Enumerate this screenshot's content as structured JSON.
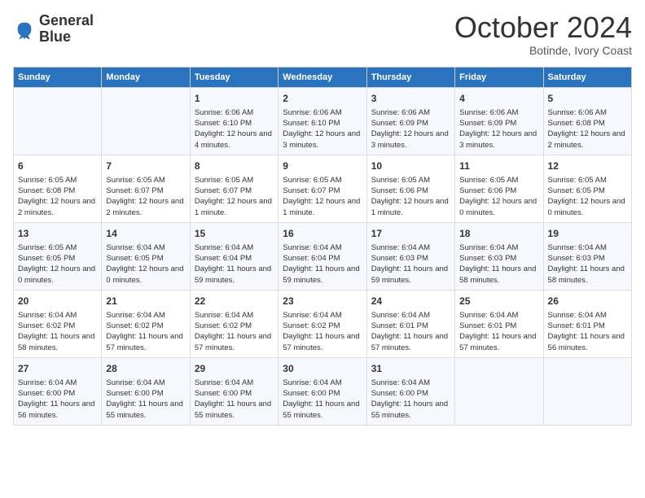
{
  "logo": {
    "line1": "General",
    "line2": "Blue"
  },
  "header": {
    "month": "October 2024",
    "location": "Botinde, Ivory Coast"
  },
  "weekdays": [
    "Sunday",
    "Monday",
    "Tuesday",
    "Wednesday",
    "Thursday",
    "Friday",
    "Saturday"
  ],
  "weeks": [
    [
      {
        "day": "",
        "info": ""
      },
      {
        "day": "",
        "info": ""
      },
      {
        "day": "1",
        "info": "Sunrise: 6:06 AM\nSunset: 6:10 PM\nDaylight: 12 hours and 4 minutes."
      },
      {
        "day": "2",
        "info": "Sunrise: 6:06 AM\nSunset: 6:10 PM\nDaylight: 12 hours and 3 minutes."
      },
      {
        "day": "3",
        "info": "Sunrise: 6:06 AM\nSunset: 6:09 PM\nDaylight: 12 hours and 3 minutes."
      },
      {
        "day": "4",
        "info": "Sunrise: 6:06 AM\nSunset: 6:09 PM\nDaylight: 12 hours and 3 minutes."
      },
      {
        "day": "5",
        "info": "Sunrise: 6:06 AM\nSunset: 6:08 PM\nDaylight: 12 hours and 2 minutes."
      }
    ],
    [
      {
        "day": "6",
        "info": "Sunrise: 6:05 AM\nSunset: 6:08 PM\nDaylight: 12 hours and 2 minutes."
      },
      {
        "day": "7",
        "info": "Sunrise: 6:05 AM\nSunset: 6:07 PM\nDaylight: 12 hours and 2 minutes."
      },
      {
        "day": "8",
        "info": "Sunrise: 6:05 AM\nSunset: 6:07 PM\nDaylight: 12 hours and 1 minute."
      },
      {
        "day": "9",
        "info": "Sunrise: 6:05 AM\nSunset: 6:07 PM\nDaylight: 12 hours and 1 minute."
      },
      {
        "day": "10",
        "info": "Sunrise: 6:05 AM\nSunset: 6:06 PM\nDaylight: 12 hours and 1 minute."
      },
      {
        "day": "11",
        "info": "Sunrise: 6:05 AM\nSunset: 6:06 PM\nDaylight: 12 hours and 0 minutes."
      },
      {
        "day": "12",
        "info": "Sunrise: 6:05 AM\nSunset: 6:05 PM\nDaylight: 12 hours and 0 minutes."
      }
    ],
    [
      {
        "day": "13",
        "info": "Sunrise: 6:05 AM\nSunset: 6:05 PM\nDaylight: 12 hours and 0 minutes."
      },
      {
        "day": "14",
        "info": "Sunrise: 6:04 AM\nSunset: 6:05 PM\nDaylight: 12 hours and 0 minutes."
      },
      {
        "day": "15",
        "info": "Sunrise: 6:04 AM\nSunset: 6:04 PM\nDaylight: 11 hours and 59 minutes."
      },
      {
        "day": "16",
        "info": "Sunrise: 6:04 AM\nSunset: 6:04 PM\nDaylight: 11 hours and 59 minutes."
      },
      {
        "day": "17",
        "info": "Sunrise: 6:04 AM\nSunset: 6:03 PM\nDaylight: 11 hours and 59 minutes."
      },
      {
        "day": "18",
        "info": "Sunrise: 6:04 AM\nSunset: 6:03 PM\nDaylight: 11 hours and 58 minutes."
      },
      {
        "day": "19",
        "info": "Sunrise: 6:04 AM\nSunset: 6:03 PM\nDaylight: 11 hours and 58 minutes."
      }
    ],
    [
      {
        "day": "20",
        "info": "Sunrise: 6:04 AM\nSunset: 6:02 PM\nDaylight: 11 hours and 58 minutes."
      },
      {
        "day": "21",
        "info": "Sunrise: 6:04 AM\nSunset: 6:02 PM\nDaylight: 11 hours and 57 minutes."
      },
      {
        "day": "22",
        "info": "Sunrise: 6:04 AM\nSunset: 6:02 PM\nDaylight: 11 hours and 57 minutes."
      },
      {
        "day": "23",
        "info": "Sunrise: 6:04 AM\nSunset: 6:02 PM\nDaylight: 11 hours and 57 minutes."
      },
      {
        "day": "24",
        "info": "Sunrise: 6:04 AM\nSunset: 6:01 PM\nDaylight: 11 hours and 57 minutes."
      },
      {
        "day": "25",
        "info": "Sunrise: 6:04 AM\nSunset: 6:01 PM\nDaylight: 11 hours and 57 minutes."
      },
      {
        "day": "26",
        "info": "Sunrise: 6:04 AM\nSunset: 6:01 PM\nDaylight: 11 hours and 56 minutes."
      }
    ],
    [
      {
        "day": "27",
        "info": "Sunrise: 6:04 AM\nSunset: 6:00 PM\nDaylight: 11 hours and 56 minutes."
      },
      {
        "day": "28",
        "info": "Sunrise: 6:04 AM\nSunset: 6:00 PM\nDaylight: 11 hours and 55 minutes."
      },
      {
        "day": "29",
        "info": "Sunrise: 6:04 AM\nSunset: 6:00 PM\nDaylight: 11 hours and 55 minutes."
      },
      {
        "day": "30",
        "info": "Sunrise: 6:04 AM\nSunset: 6:00 PM\nDaylight: 11 hours and 55 minutes."
      },
      {
        "day": "31",
        "info": "Sunrise: 6:04 AM\nSunset: 6:00 PM\nDaylight: 11 hours and 55 minutes."
      },
      {
        "day": "",
        "info": ""
      },
      {
        "day": "",
        "info": ""
      }
    ]
  ]
}
